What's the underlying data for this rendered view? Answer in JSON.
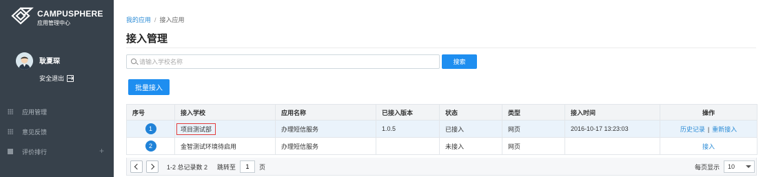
{
  "sidebar": {
    "brand_name": "CAMPUSPHERE",
    "brand_sub": "应用管理中心",
    "user_name": "耿夏琛",
    "logout_label": "安全退出",
    "nav": [
      {
        "label": "应用管理",
        "icon": "grid-icon"
      },
      {
        "label": "意见反馈",
        "icon": "grid-icon"
      },
      {
        "label": "评价排行",
        "icon": "chart-icon",
        "expand": "+"
      }
    ]
  },
  "breadcrumb": {
    "home": "我的应用",
    "separator": "/",
    "current": "接入应用"
  },
  "page_title": "接入管理",
  "search": {
    "placeholder": "请输入学校名称",
    "value": "",
    "button_label": "搜索"
  },
  "batch_button_label": "批量接入",
  "table": {
    "headers": [
      "序号",
      "接入学校",
      "应用名称",
      "已接入版本",
      "状态",
      "类型",
      "接入时间",
      "操作"
    ],
    "rows": [
      {
        "num": "1",
        "school": "项目测试部",
        "app": "办理短信服务",
        "version": "1.0.5",
        "status": "已接入",
        "type": "网页",
        "time": "2016-10-17 13:23:03",
        "op1": "历史记录",
        "op_sep": "|",
        "op2": "重新接入"
      },
      {
        "num": "2",
        "school": "金智测试环境待启用",
        "app": "办理短信服务",
        "version": "",
        "status": "未接入",
        "type": "网页",
        "time": "",
        "op1": "接入",
        "op_sep": "",
        "op2": ""
      }
    ]
  },
  "pager": {
    "summary": "1-2 总记录数 2",
    "goto_label": "跳转至",
    "goto_value": "1",
    "page_unit": "页",
    "page_size_label": "每页显示",
    "page_size": "10"
  },
  "colors": {
    "sidebar_bg": "#37414b",
    "accent": "#1e8ef0",
    "link": "#2a8bd6",
    "highlight_border": "#e23b3b"
  }
}
